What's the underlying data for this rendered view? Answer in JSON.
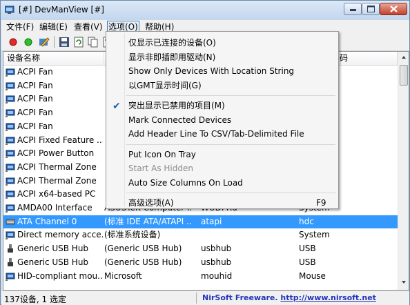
{
  "window": {
    "title": "[#] DevManView [#]"
  },
  "menubar": {
    "file": "文件(F)",
    "edit": "编辑(E)",
    "view": "查看(V)",
    "options": "选项(O)",
    "help": "帮助(H)"
  },
  "toolbar": {
    "buttons": [
      "disable-red-icon",
      "enable-green-icon",
      "edit-icon",
      "properties-icon",
      "save-icon",
      "refresh-icon",
      "copy-icon",
      "html-report-icon"
    ]
  },
  "list": {
    "columns": [
      "设备名称",
      "",
      "",
      "码"
    ],
    "rows": [
      {
        "name": "ACPI Fan",
        "c1": "",
        "c2": "",
        "c3": "",
        "icon": "device-icon"
      },
      {
        "name": "ACPI Fan",
        "c1": "",
        "c2": "",
        "c3": "",
        "icon": "device-icon"
      },
      {
        "name": "ACPI Fan",
        "c1": "",
        "c2": "",
        "c3": "",
        "icon": "device-icon"
      },
      {
        "name": "ACPI Fan",
        "c1": "",
        "c2": "",
        "c3": "",
        "icon": "device-icon"
      },
      {
        "name": "ACPI Fan",
        "c1": "",
        "c2": "",
        "c3": "",
        "icon": "device-icon"
      },
      {
        "name": "ACPI Fixed Feature ...",
        "c1": "",
        "c2": "",
        "c3": "",
        "icon": "device-icon"
      },
      {
        "name": "ACPI Power Button",
        "c1": "",
        "c2": "",
        "c3": "",
        "icon": "device-icon"
      },
      {
        "name": "ACPI Thermal Zone",
        "c1": "",
        "c2": "",
        "c3": "",
        "icon": "device-icon"
      },
      {
        "name": "ACPI Thermal Zone",
        "c1": "",
        "c2": "",
        "c3": "",
        "icon": "device-icon"
      },
      {
        "name": "ACPI x64-based PC",
        "c1": "",
        "c2": "",
        "c3": "",
        "icon": "device-icon"
      },
      {
        "name": "AMDA00 Interface",
        "c1": "ASUSTeK Computer I...",
        "c2": "WUDFRd",
        "c3": "System",
        "icon": "device-icon"
      },
      {
        "name": "ATA Channel 0",
        "c1": "(标准 IDE ATA/ATAPI ...",
        "c2": "atapi",
        "c3": "hdc",
        "icon": "ide-channel-icon",
        "selected": true
      },
      {
        "name": "Direct memory acce...",
        "c1": "(标准系统设备)",
        "c2": "",
        "c3": "System",
        "icon": "device-icon"
      },
      {
        "name": "Generic USB Hub",
        "c1": "(Generic USB Hub)",
        "c2": "usbhub",
        "c3": "USB",
        "icon": "usb-icon"
      },
      {
        "name": "Generic USB Hub",
        "c1": "(Generic USB Hub)",
        "c2": "usbhub",
        "c3": "USB",
        "icon": "usb-icon"
      },
      {
        "name": "HID-compliant mou...",
        "c1": "Microsoft",
        "c2": "mouhid",
        "c3": "Mouse",
        "icon": "device-icon"
      }
    ]
  },
  "options_menu": {
    "items": [
      {
        "label": "仅显示已连接的设备(O)",
        "checked": false,
        "disabled": false,
        "shortcut": ""
      },
      {
        "label": "显示非即插即用驱动(N)",
        "checked": false,
        "disabled": false,
        "shortcut": ""
      },
      {
        "label": "Show Only Devices With Location String",
        "checked": false,
        "disabled": false,
        "shortcut": ""
      },
      {
        "label": "以GMT显示时间(G)",
        "checked": false,
        "disabled": false,
        "shortcut": ""
      },
      {
        "separator": true
      },
      {
        "label": "突出显示已禁用的项目(M)",
        "checked": true,
        "disabled": false,
        "shortcut": ""
      },
      {
        "label": "Mark Connected Devices",
        "checked": false,
        "disabled": false,
        "shortcut": ""
      },
      {
        "label": "Add Header Line To CSV/Tab-Delimited File",
        "checked": false,
        "disabled": false,
        "shortcut": ""
      },
      {
        "separator": true
      },
      {
        "label": "Put Icon On Tray",
        "checked": false,
        "disabled": false,
        "shortcut": ""
      },
      {
        "label": "Start As Hidden",
        "checked": false,
        "disabled": true,
        "shortcut": ""
      },
      {
        "label": "Auto Size Columns On Load",
        "checked": false,
        "disabled": false,
        "shortcut": ""
      },
      {
        "separator": true
      },
      {
        "label": "高级选项(A)",
        "checked": false,
        "disabled": false,
        "shortcut": "F9"
      }
    ]
  },
  "statusbar": {
    "count": "137设备, 1 选定",
    "credit_prefix": "NirSoft Freeware.  ",
    "credit_link": "http://www.nirsoft.net"
  },
  "colors": {
    "selection": "#3399ff",
    "check": "#1a5fb4",
    "link": "#2233bb"
  }
}
